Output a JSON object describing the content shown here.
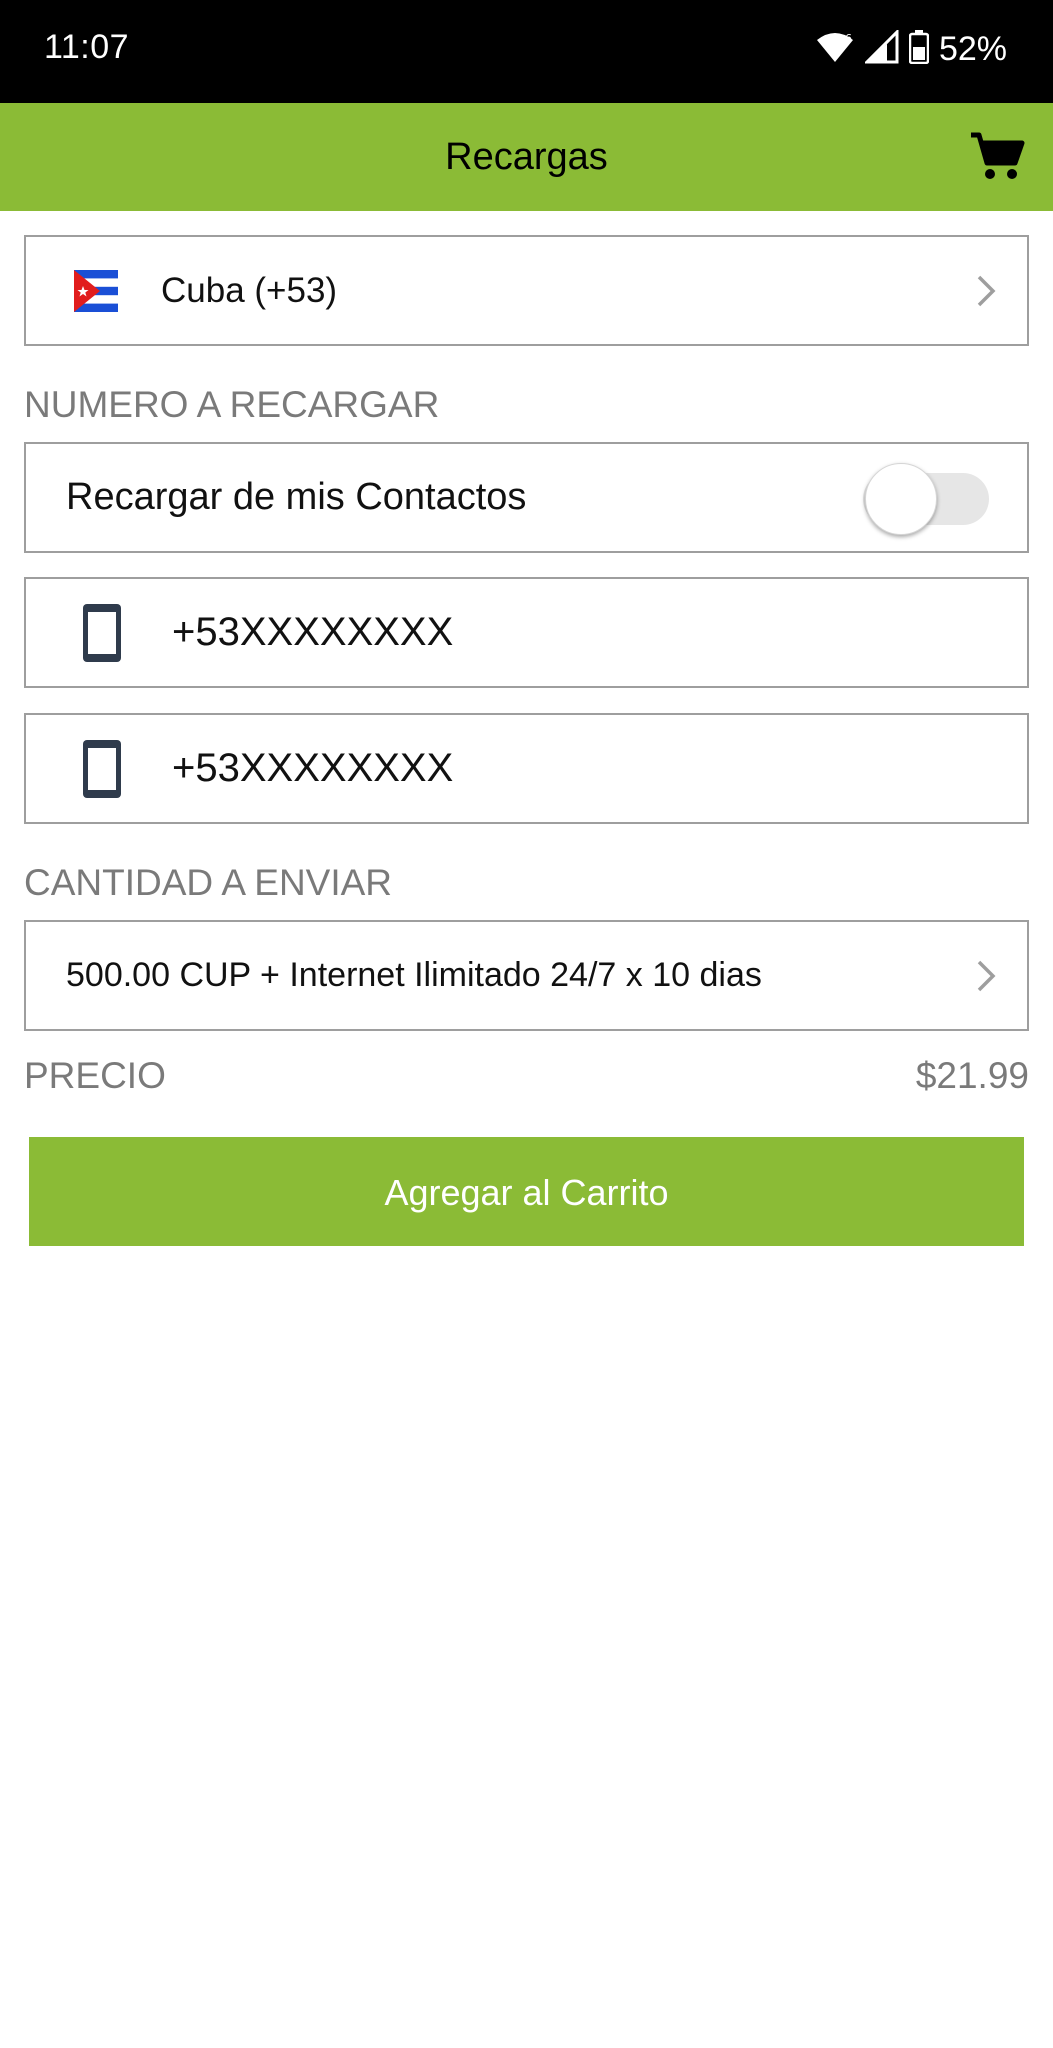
{
  "status_bar": {
    "time": "11:07",
    "battery": "52%",
    "icons": [
      "wifi-icon",
      "signal-icon",
      "battery-icon"
    ]
  },
  "app_bar": {
    "title": "Recargas",
    "cart_icon": "cart-icon"
  },
  "country_selector": {
    "label": "Cuba (+53)",
    "flag_icon": "cuba-flag-icon"
  },
  "recharge_number": {
    "section_title": "NUMERO A RECARGAR",
    "contacts_toggle_label": "Recargar de mis Contactos",
    "contacts_toggle_on": false,
    "phone_fields": [
      {
        "value": "+53XXXXXXXX"
      },
      {
        "value": "+53XXXXXXXX"
      }
    ]
  },
  "amount": {
    "section_title": "CANTIDAD A ENVIAR",
    "selected": "500.00 CUP + Internet Ilimitado 24/7 x 10 dias"
  },
  "price": {
    "label": "PRECIO",
    "value": "$21.99"
  },
  "add_to_cart": {
    "label": "Agregar al Carrito"
  },
  "colors": {
    "accent": "#8bbb36",
    "status_bar": "#000000",
    "muted_text": "#7a7a7a",
    "border": "#9e9e9e",
    "icon_dark": "#2f3b4c"
  }
}
